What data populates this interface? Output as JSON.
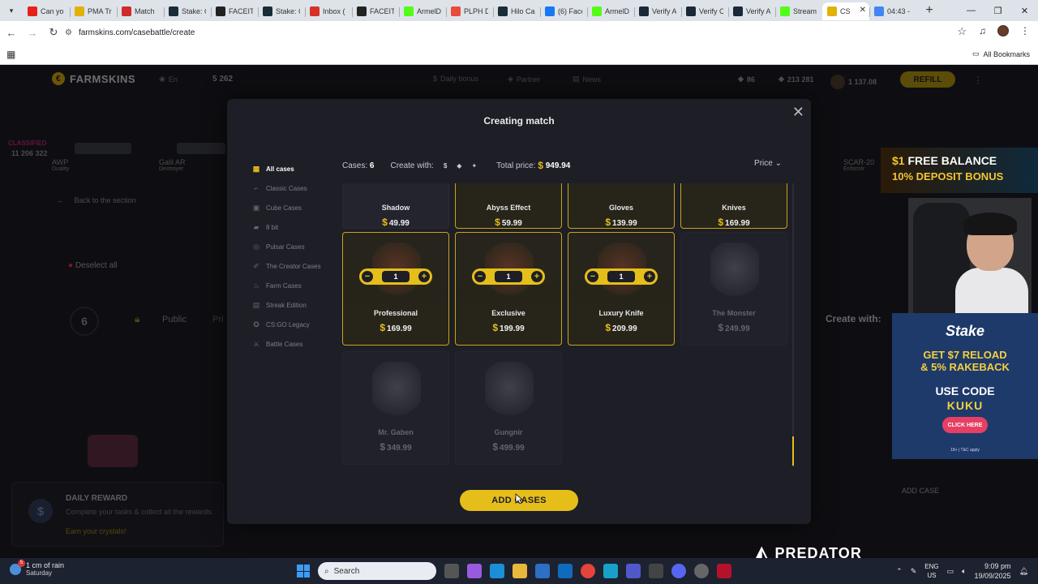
{
  "browser": {
    "tabs": [
      {
        "label": "Can yo",
        "icon": "youtube-icon",
        "color": "#e62117"
      },
      {
        "label": "PMA Tr",
        "icon": "coin-icon",
        "color": "#e2b007"
      },
      {
        "label": "Match",
        "icon": "d-logo-icon",
        "color": "#d12a2a"
      },
      {
        "label": "Stake: C",
        "icon": "s-logo-icon",
        "color": "#1a2c38"
      },
      {
        "label": "FACEIT",
        "icon": "faceit-icon",
        "color": "#222"
      },
      {
        "label": "Stake: C",
        "icon": "s-logo-icon",
        "color": "#1a2c38"
      },
      {
        "label": "Inbox (",
        "icon": "gmail-icon",
        "color": "#d93025"
      },
      {
        "label": "FACEIT",
        "icon": "faceit-icon",
        "color": "#222"
      },
      {
        "label": "ArmelD",
        "icon": "kick-icon",
        "color": "#53fc18"
      },
      {
        "label": "PLPH D",
        "icon": "plph-icon",
        "color": "#e94b3c"
      },
      {
        "label": "Hilo Ca",
        "icon": "s-logo-icon",
        "color": "#1a2c38"
      },
      {
        "label": "(6) Face",
        "icon": "facebook-icon",
        "color": "#1877f2"
      },
      {
        "label": "ArmelD",
        "icon": "kick-icon",
        "color": "#53fc18"
      },
      {
        "label": "Verify A",
        "icon": "steam-icon",
        "color": "#1b2838"
      },
      {
        "label": "Verify C",
        "icon": "steam-icon",
        "color": "#1b2838"
      },
      {
        "label": "Verify A",
        "icon": "steam-icon",
        "color": "#1b2838"
      },
      {
        "label": "Stream",
        "icon": "kick-icon",
        "color": "#53fc18"
      },
      {
        "label": "CS",
        "icon": "coin-icon",
        "color": "#e2b007",
        "active": true
      },
      {
        "label": "04:43 -",
        "icon": "google-icon",
        "color": "#4285f4"
      }
    ],
    "url": "farmskins.com/casebattle/create",
    "all_bookmarks": "All Bookmarks"
  },
  "site": {
    "logo": "FARMSKINS",
    "lang": "En",
    "balance_top": "5 262",
    "nav": [
      "Daily bonus",
      "Partner",
      "News"
    ],
    "stat1": "86",
    "stat2": "213 281",
    "user_balance": "1 137.08",
    "refill": "REFILL",
    "back": "Back to the section",
    "deselect": "Deselect all",
    "case_count": "6",
    "public": "Public",
    "private_partial": "Pri",
    "create_with": "Create with:",
    "add_case": "ADD CASE",
    "bg_drop_name": "AWP",
    "bg_drop_sub": "Duality",
    "bg_drop2_name": "Galil AR",
    "bg_drop2_sub": "Destroyer",
    "bg_drop3_name": "SCAR-20",
    "bg_drop3_sub": "Enforcer",
    "bg_left_value": "11 206 322",
    "bg_left_label": "CLASSIFIED",
    "daily_title": "DAILY REWARD",
    "daily_desc": "Complete your tasks & collect all the rewards.",
    "daily_link": "Earn your crystals!"
  },
  "modal": {
    "title": "Creating match",
    "categories": [
      {
        "label": "All cases",
        "icon": "grid-icon",
        "active": true
      },
      {
        "label": "Classic Cases",
        "icon": "gun-icon"
      },
      {
        "label": "Cube Cases",
        "icon": "cube-icon"
      },
      {
        "label": "8 bit",
        "icon": "pixel-gun-icon"
      },
      {
        "label": "Pulsar Cases",
        "icon": "pulsar-icon"
      },
      {
        "label": "The Creator Cases",
        "icon": "creator-icon"
      },
      {
        "label": "Farm Cases",
        "icon": "farm-icon"
      },
      {
        "label": "Streak Edition",
        "icon": "streak-icon"
      },
      {
        "label": "CS:GO Legacy",
        "icon": "csgo-icon"
      },
      {
        "label": "Battle Cases",
        "icon": "battle-icon"
      }
    ],
    "cases_label": "Cases:",
    "cases_count": "6",
    "create_with": "Create with:",
    "total_label": "Total price:",
    "total_value": "949.94",
    "sort": "Price",
    "currency": "$",
    "cases_row1": [
      {
        "name": "Shadow",
        "price": "49.99",
        "selected": false
      },
      {
        "name": "Abyss Effect",
        "price": "59.99",
        "selected": true
      },
      {
        "name": "Gloves",
        "price": "139.99",
        "selected": true
      },
      {
        "name": "Knives",
        "price": "169.99",
        "selected": true
      }
    ],
    "cases_row2": [
      {
        "name": "Professional",
        "price": "169.99",
        "qty": "1",
        "selected": true
      },
      {
        "name": "Exclusive",
        "price": "199.99",
        "qty": "1",
        "selected": true
      },
      {
        "name": "Luxury Knife",
        "price": "209.99",
        "qty": "1",
        "selected": true
      },
      {
        "name": "The Monster",
        "price": "249.99",
        "selected": false
      }
    ],
    "cases_row3": [
      {
        "name": "Mr. Gaben",
        "price": "349.99",
        "selected": false
      },
      {
        "name": "Gungnir",
        "price": "499.99",
        "selected": false
      }
    ],
    "add_button": "ADD CASES"
  },
  "overlays": {
    "ad1_line1a": "$1",
    "ad1_line1b": " FREE BALANCE",
    "ad1_line2": "10% DEPOSIT BONUS",
    "ad2_logo": "Stake",
    "ad2_line1": "GET $7 RELOAD",
    "ad2_line2": "& 5% RAKEBACK",
    "ad2_line3": "USE CODE",
    "ad2_code": "KUKU",
    "ad2_btn": "CLICK HERE",
    "ad2_tc": "18+ | T&C apply",
    "predator": "PREDATOR"
  },
  "taskbar": {
    "weather_badge": "5",
    "weather_line1": "1 cm of rain",
    "weather_line2": "Saturday",
    "search": "Search",
    "lang1": "ENG",
    "lang2": "US",
    "time": "9:09 pm",
    "date": "19/09/2025"
  }
}
